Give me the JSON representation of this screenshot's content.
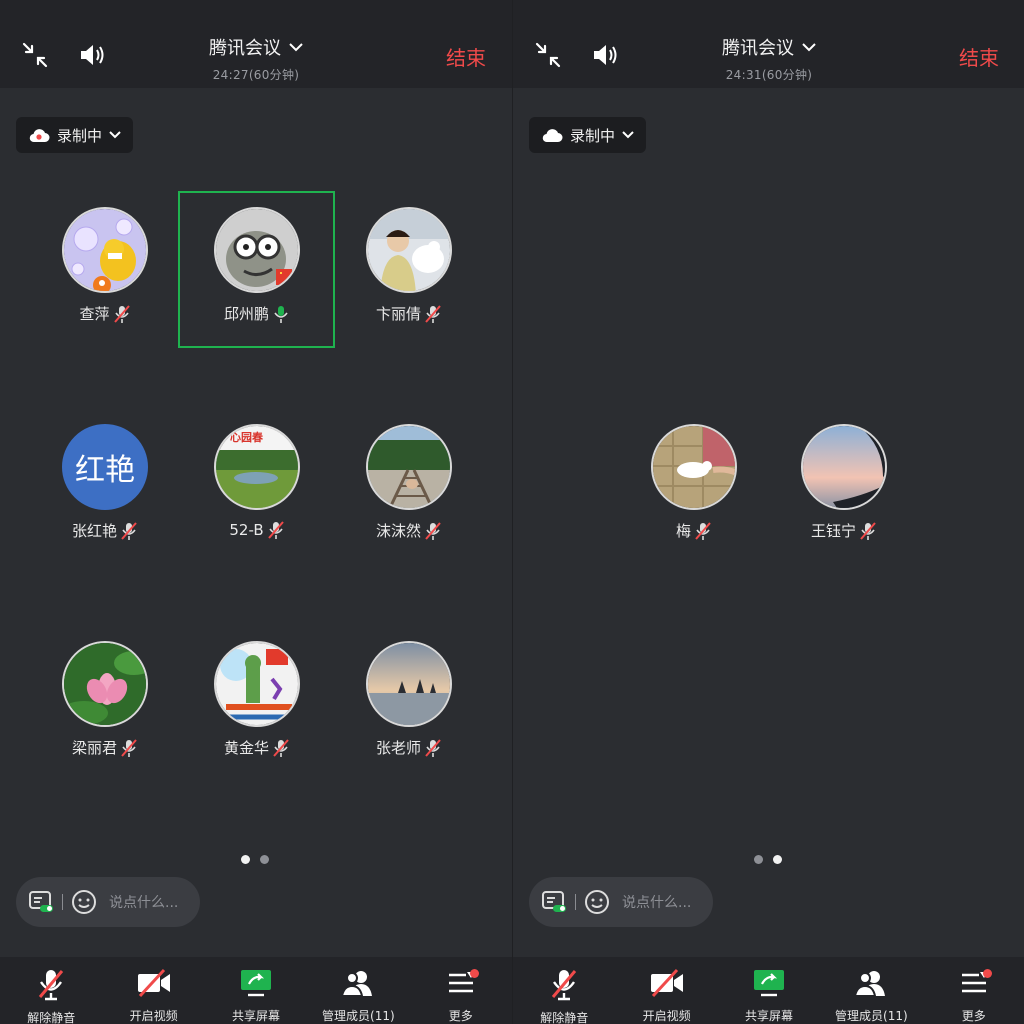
{
  "left": {
    "title": "腾讯会议",
    "timer": "24:27(60分钟)",
    "end_label": "结束",
    "recording_label": "录制中",
    "chat_placeholder": "说点什么...",
    "participants": [
      {
        "name": "查萍",
        "mic": "muted",
        "avatar": "duck-bubbles"
      },
      {
        "name": "邱州鹏",
        "mic": "speaking",
        "avatar": "cartoon-goggles"
      },
      {
        "name": "卞丽倩",
        "mic": "muted",
        "avatar": "woman-with-bird"
      },
      {
        "name": "张红艳",
        "mic": "muted",
        "avatar": "text",
        "avatar_text": "红艳"
      },
      {
        "name": "52-B",
        "mic": "muted",
        "avatar": "park-landscape",
        "avatar_text": "心园春"
      },
      {
        "name": "沫沫然",
        "mic": "muted",
        "avatar": "railway-forest"
      },
      {
        "name": "梁丽君",
        "mic": "muted",
        "avatar": "lotus-flower"
      },
      {
        "name": "黄金华",
        "mic": "muted",
        "avatar": "motivation-poster"
      },
      {
        "name": "张老师",
        "mic": "muted",
        "avatar": "sunset-sea"
      }
    ],
    "page_dots": {
      "count": 2,
      "active": 0
    }
  },
  "right": {
    "title": "腾讯会议",
    "timer": "24:31(60分钟)",
    "end_label": "结束",
    "recording_label": "录制中",
    "chat_placeholder": "说点什么...",
    "participants": [
      {
        "name": "梅",
        "mic": "muted",
        "avatar": "white-dove-hand"
      },
      {
        "name": "王钰宁",
        "mic": "muted",
        "avatar": "sunset-hand"
      }
    ],
    "page_dots": {
      "count": 2,
      "active": 1
    }
  },
  "toolbar": [
    {
      "label": "解除静音",
      "icon": "mic-muted-icon"
    },
    {
      "label": "开启视频",
      "icon": "camera-off-icon"
    },
    {
      "label": "共享屏幕",
      "icon": "share-screen-icon"
    },
    {
      "label": "管理成员(11)",
      "icon": "members-icon"
    },
    {
      "label": "更多",
      "icon": "more-menu-icon",
      "badge": true
    }
  ],
  "colors": {
    "accent_green": "#1fb34f",
    "end_red": "#f04a4a",
    "record_red": "#f04a4a",
    "avatar_blue": "#3d6fc4"
  }
}
